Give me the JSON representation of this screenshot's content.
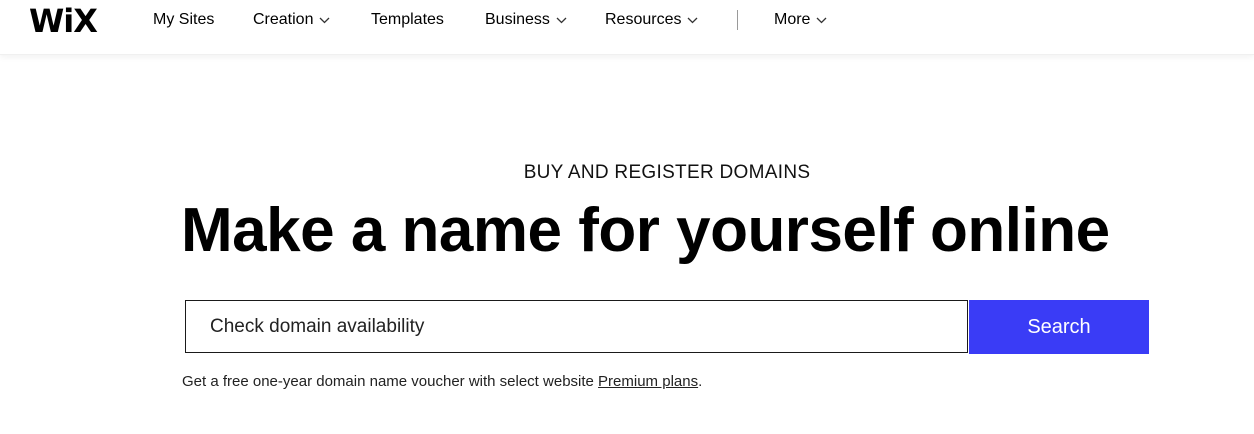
{
  "brand": {
    "logo_text": "WiX"
  },
  "nav": {
    "items": [
      {
        "label": "My Sites",
        "has_dropdown": false
      },
      {
        "label": "Creation",
        "has_dropdown": true
      },
      {
        "label": "Templates",
        "has_dropdown": false
      },
      {
        "label": "Business",
        "has_dropdown": true
      },
      {
        "label": "Resources",
        "has_dropdown": true
      },
      {
        "label": "More",
        "has_dropdown": true
      }
    ]
  },
  "hero": {
    "eyebrow": "BUY AND REGISTER DOMAINS",
    "headline": "Make a name for yourself online"
  },
  "search": {
    "placeholder": "Check domain availability",
    "button_label": "Search"
  },
  "voucher": {
    "text_before": "Get a free one-year domain name voucher with select website ",
    "link_label": "Premium plans",
    "text_after": "."
  },
  "colors": {
    "accent": "#3a3cf6",
    "text": "#000000",
    "background": "#ffffff"
  },
  "icons": {
    "dropdown": "chevron-down-icon"
  }
}
